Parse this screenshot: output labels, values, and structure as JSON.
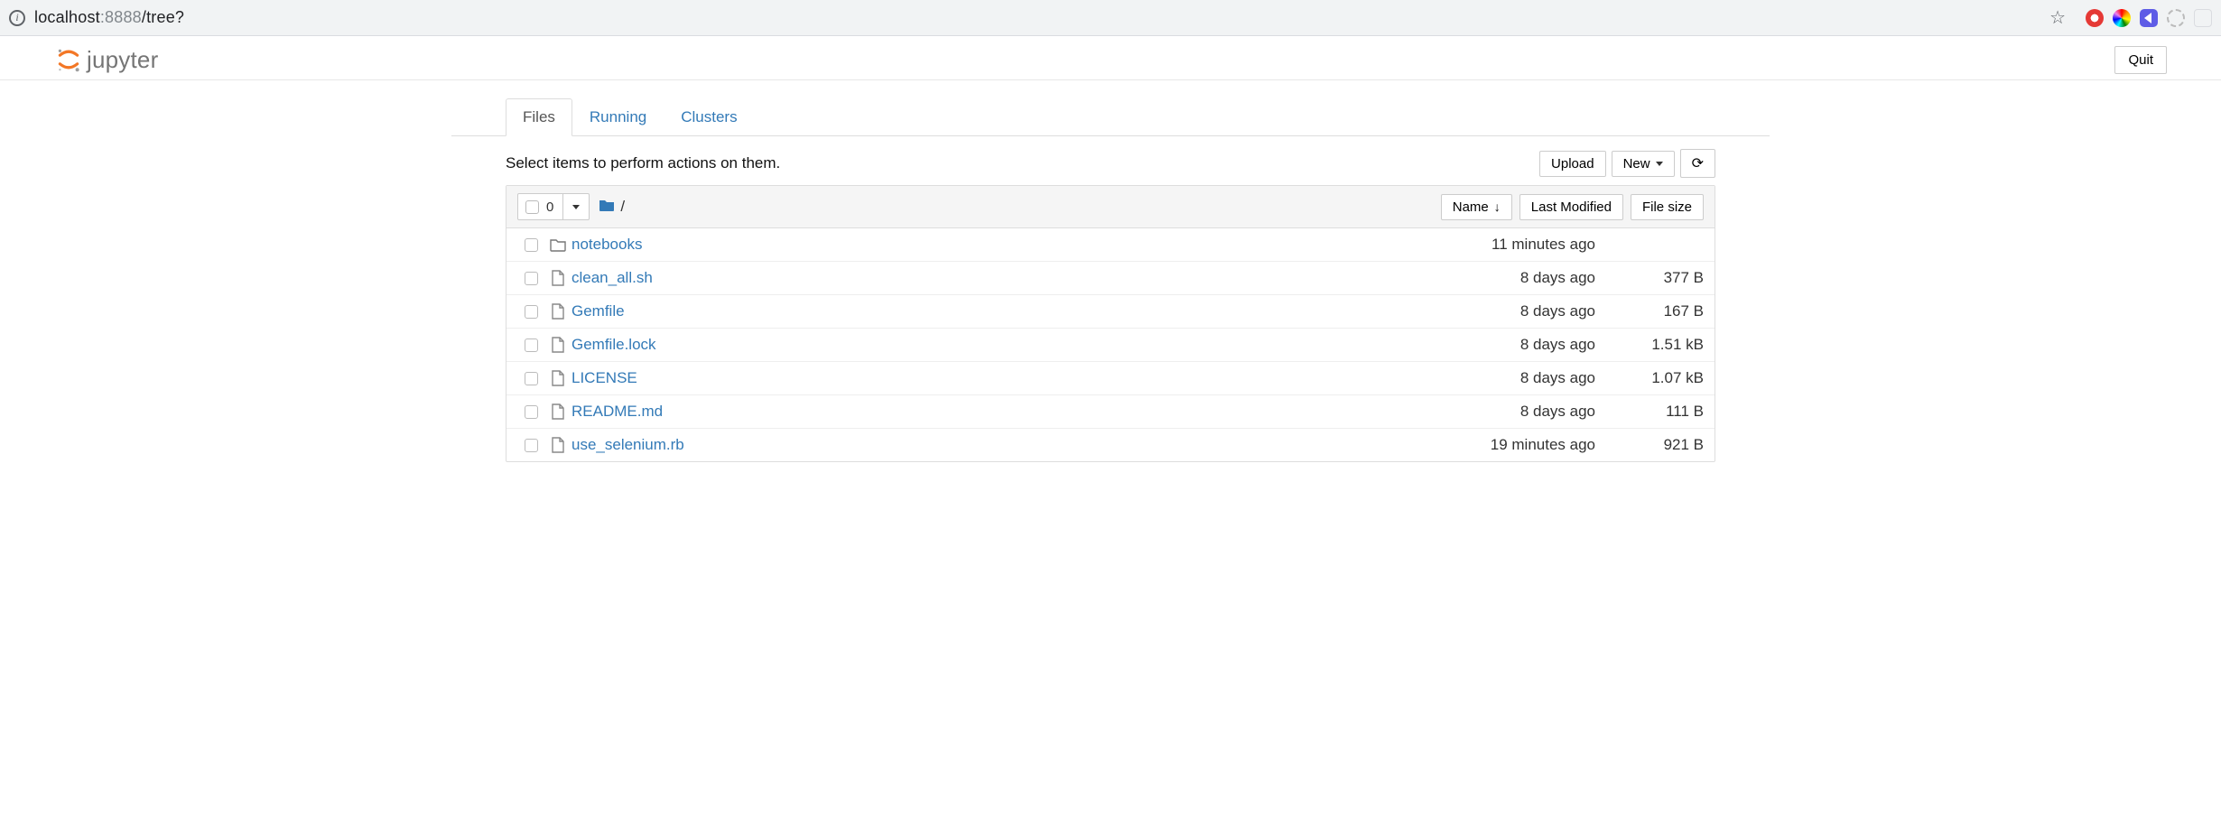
{
  "browser": {
    "url_prefix": "localhost",
    "url_port": ":8888",
    "url_path": "/tree?"
  },
  "header": {
    "brand": "jupyter",
    "quit_label": "Quit"
  },
  "tabs": {
    "files": "Files",
    "running": "Running",
    "clusters": "Clusters"
  },
  "actions": {
    "hint": "Select items to perform actions on them.",
    "upload_label": "Upload",
    "new_label": "New"
  },
  "list_header": {
    "selected_count": "0",
    "breadcrumb_root": "/",
    "name_col": "Name",
    "modified_col": "Last Modified",
    "size_col": "File size"
  },
  "rows": [
    {
      "type": "folder",
      "name": "notebooks",
      "modified": "11 minutes ago",
      "size": ""
    },
    {
      "type": "file",
      "name": "clean_all.sh",
      "modified": "8 days ago",
      "size": "377 B"
    },
    {
      "type": "file",
      "name": "Gemfile",
      "modified": "8 days ago",
      "size": "167 B"
    },
    {
      "type": "file",
      "name": "Gemfile.lock",
      "modified": "8 days ago",
      "size": "1.51 kB"
    },
    {
      "type": "file",
      "name": "LICENSE",
      "modified": "8 days ago",
      "size": "1.07 kB"
    },
    {
      "type": "file",
      "name": "README.md",
      "modified": "8 days ago",
      "size": "111 B"
    },
    {
      "type": "file",
      "name": "use_selenium.rb",
      "modified": "19 minutes ago",
      "size": "921 B"
    }
  ]
}
